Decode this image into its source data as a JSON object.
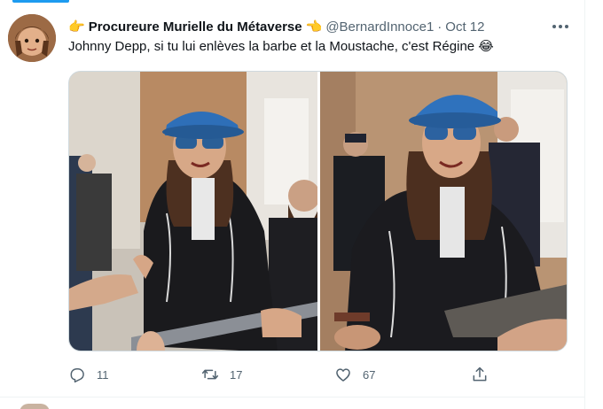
{
  "tweet": {
    "author": {
      "display_name": "Procureure Murielle du Métaverse",
      "emoji_before": "👉",
      "emoji_after": "👈",
      "handle": "@BernardInnoce1",
      "separator": "·",
      "timestamp": "Oct 12"
    },
    "text": "Johnny Depp, si tu lui enlèves la barbe et la Moustache, c'est Régine 😂",
    "more_icon": "more-horizontal-icon",
    "media": {
      "count": 2
    },
    "actions": {
      "reply": {
        "icon": "reply-icon",
        "count": "11"
      },
      "retweet": {
        "icon": "retweet-icon",
        "count": "17"
      },
      "like": {
        "icon": "heart-icon",
        "count": "67"
      },
      "share": {
        "icon": "share-icon"
      }
    }
  },
  "colors": {
    "accent": "#1d9bf0",
    "text_primary": "#0f1419",
    "text_secondary": "#536471",
    "border": "#cfd9de"
  }
}
